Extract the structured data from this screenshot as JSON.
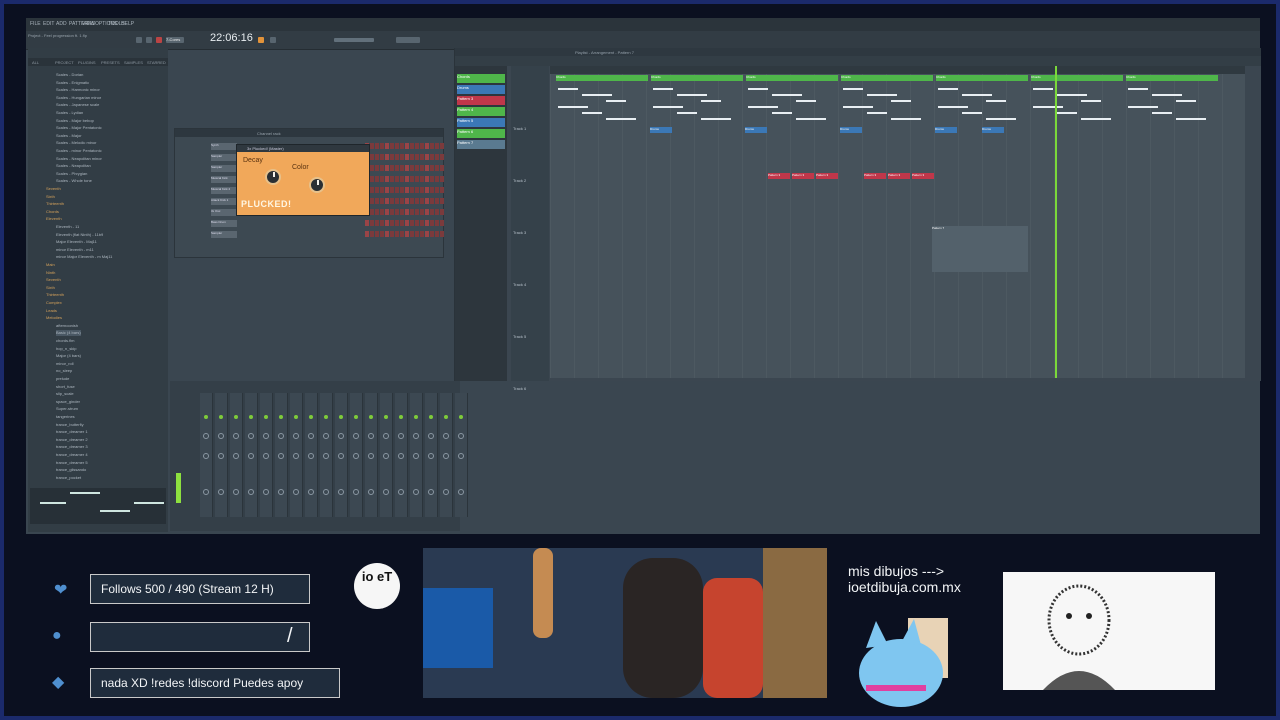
{
  "app": {
    "menu": [
      "FILE",
      "EDIT",
      "ADD",
      "PATTERNS",
      "VIEW",
      "OPTIONS",
      "TOOLS",
      "HELP"
    ],
    "time": "22:06:16",
    "song_info": "Project - Feel progression ft. 1.flp",
    "tempo_label": "7-Cores"
  },
  "browser": {
    "tabs": [
      "ALL",
      "PROJECT",
      "PLUGINS",
      "PRESETS",
      "SAMPLES",
      "STARRED"
    ],
    "items": [
      {
        "label": "Scales - Dorian",
        "folder": false
      },
      {
        "label": "Scales - Enigmatic",
        "folder": false
      },
      {
        "label": "Scales - Harmonic minor",
        "folder": false
      },
      {
        "label": "Scales - Hungarian minor",
        "folder": false
      },
      {
        "label": "Scales - Japanese scale",
        "folder": false
      },
      {
        "label": "Scales - Lydian",
        "folder": false
      },
      {
        "label": "Scales - Major bebop",
        "folder": false
      },
      {
        "label": "Scales - Major Pentatonic",
        "folder": false
      },
      {
        "label": "Scales - Major",
        "folder": false
      },
      {
        "label": "Scales - Melodic minor",
        "folder": false
      },
      {
        "label": "Scales - minor Pentatonic",
        "folder": false
      },
      {
        "label": "Scales - Neapolitan minor",
        "folder": false
      },
      {
        "label": "Scales - Neapolitan",
        "folder": false
      },
      {
        "label": "Scales - Phrygian",
        "folder": false
      },
      {
        "label": "Scales - Whole tone",
        "folder": false
      },
      {
        "label": "Seventh",
        "folder": true
      },
      {
        "label": "Sixth",
        "folder": true
      },
      {
        "label": "Thirteenth",
        "folder": true
      },
      {
        "label": "Chords",
        "folder": true
      },
      {
        "label": "Eleventh",
        "folder": true
      },
      {
        "label": "Eleventh - 11",
        "folder": false
      },
      {
        "label": "Eleventh (flat Ninth) - 11b9",
        "folder": false
      },
      {
        "label": "Major Eleventh - Maj11",
        "folder": false
      },
      {
        "label": "minor Eleventh - m11",
        "folder": false
      },
      {
        "label": "minor Major Eleventh - m Maj11",
        "folder": false
      },
      {
        "label": "Main",
        "folder": true
      },
      {
        "label": "Ninth",
        "folder": true
      },
      {
        "label": "Seventh",
        "folder": true
      },
      {
        "label": "Sixth",
        "folder": true
      },
      {
        "label": "Thirteenth",
        "folder": true
      },
      {
        "label": "Complex",
        "folder": true
      },
      {
        "label": "Leads",
        "folder": true
      },
      {
        "label": "Melodies",
        "folder": true
      },
      {
        "label": "afternoonish",
        "folder": false
      },
      {
        "label": "Basic (4 bars)",
        "folder": false
      },
      {
        "label": "chords.flm",
        "folder": false
      },
      {
        "label": "hop_n_skip",
        "folder": false
      },
      {
        "label": "Major (4 bars)",
        "folder": false
      },
      {
        "label": "minor_roll",
        "folder": false
      },
      {
        "label": "no_sleep",
        "folder": false
      },
      {
        "label": "prelude",
        "folder": false
      },
      {
        "label": "short_fuse",
        "folder": false
      },
      {
        "label": "slip_scale",
        "folder": false
      },
      {
        "label": "space_ginder",
        "folder": false
      },
      {
        "label": "Super-strum",
        "folder": false
      },
      {
        "label": "tangerines",
        "folder": false
      },
      {
        "label": "trance_butterfly",
        "folder": false
      },
      {
        "label": "trance_dreamer 1",
        "folder": false
      },
      {
        "label": "trance_dreamer 2",
        "folder": false
      },
      {
        "label": "trance_dreamer 3",
        "folder": false
      },
      {
        "label": "trance_dreamer 4",
        "folder": false
      },
      {
        "label": "trance_dreamer 5",
        "folder": false
      },
      {
        "label": "trance_glissando",
        "folder": false
      },
      {
        "label": "trance_pocket",
        "folder": false
      }
    ]
  },
  "channel_rack": {
    "title": "Channel rack",
    "channels": [
      "Synth",
      "Sampler",
      "Sampler",
      "Musical Kick",
      "Musical Kick 2",
      "Attack Kick 1",
      "3x Osc",
      "Bass Drum",
      "Sampler"
    ]
  },
  "plugin": {
    "title": "3x Plucked! (Master)",
    "decay_label": "Decay",
    "color_label": "Color",
    "name": "PLUCKED!"
  },
  "playlist": {
    "title": "Playlist - Arrangement - Pattern 7",
    "patterns": [
      {
        "label": "Chords",
        "color": "#4fb64a"
      },
      {
        "label": "Drums",
        "color": "#3b78b6"
      },
      {
        "label": "Pattern 3",
        "color": "#c0374a"
      },
      {
        "label": "Pattern 4",
        "color": "#4fb64a"
      },
      {
        "label": "Pattern 5",
        "color": "#3b78b6"
      },
      {
        "label": "Pattern 6",
        "color": "#4fb64a"
      },
      {
        "label": "Pattern 7",
        "color": "#5a7a90"
      }
    ],
    "tracks": [
      "Track 1",
      "Track 2",
      "Track 3",
      "Track 4",
      "Track 5",
      "Track 6"
    ],
    "clip_labels": {
      "chords": "Chords",
      "drums": "Drums",
      "p3": "Pattern 3",
      "p7": "Pattern 7"
    }
  },
  "overlay": {
    "follows": "Follows 500 / 490 (Stream 12 H)",
    "empty_bar": "",
    "slash": "/",
    "ticker": "nada XD !redes !discord Puedes apoy",
    "logo_text": "io eT",
    "promo_line1": "mis dibujos --->",
    "promo_line2": "ioetdibuja.com.mx"
  },
  "colors": {
    "accent_green": "#7bd83a",
    "border_blue": "#1b2a6b",
    "plugin_orange": "#f1a85a",
    "pattern_red": "#c0374a"
  }
}
